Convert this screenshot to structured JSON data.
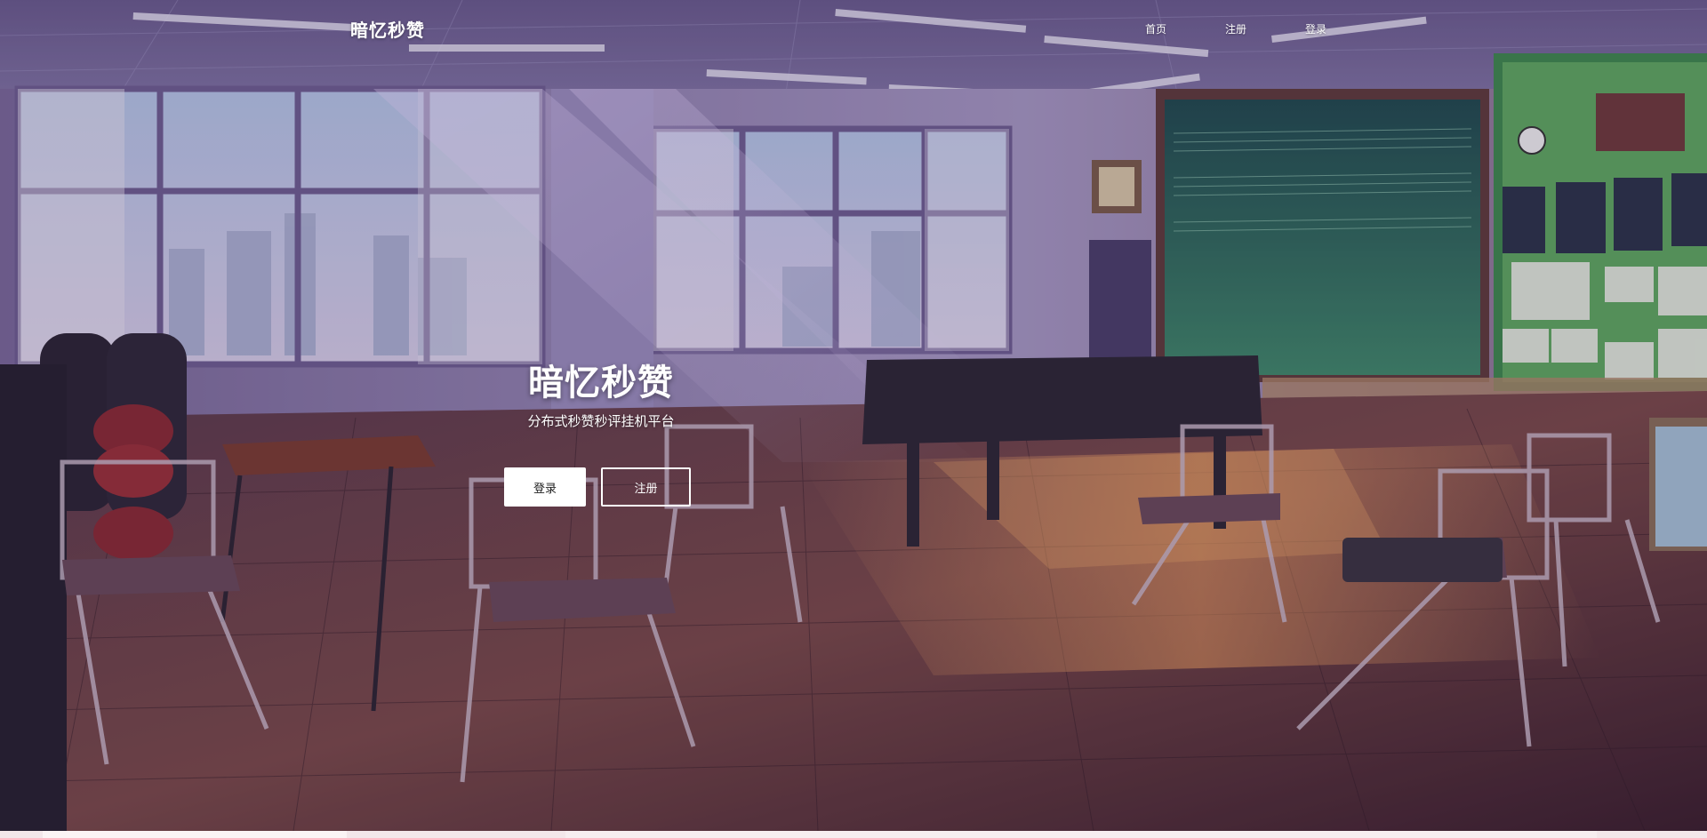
{
  "nav": {
    "brand": "暗忆秒赞",
    "links": [
      {
        "label": "首页"
      },
      {
        "label": "注册"
      },
      {
        "label": "登录"
      }
    ]
  },
  "hero": {
    "title": "暗忆秒赞",
    "subtitle": "分布式秒赞秒评挂机平台",
    "login_button": "登录",
    "register_button": "注册"
  },
  "colors": {
    "button_fill": "#ffffff",
    "text": "#ffffff"
  }
}
